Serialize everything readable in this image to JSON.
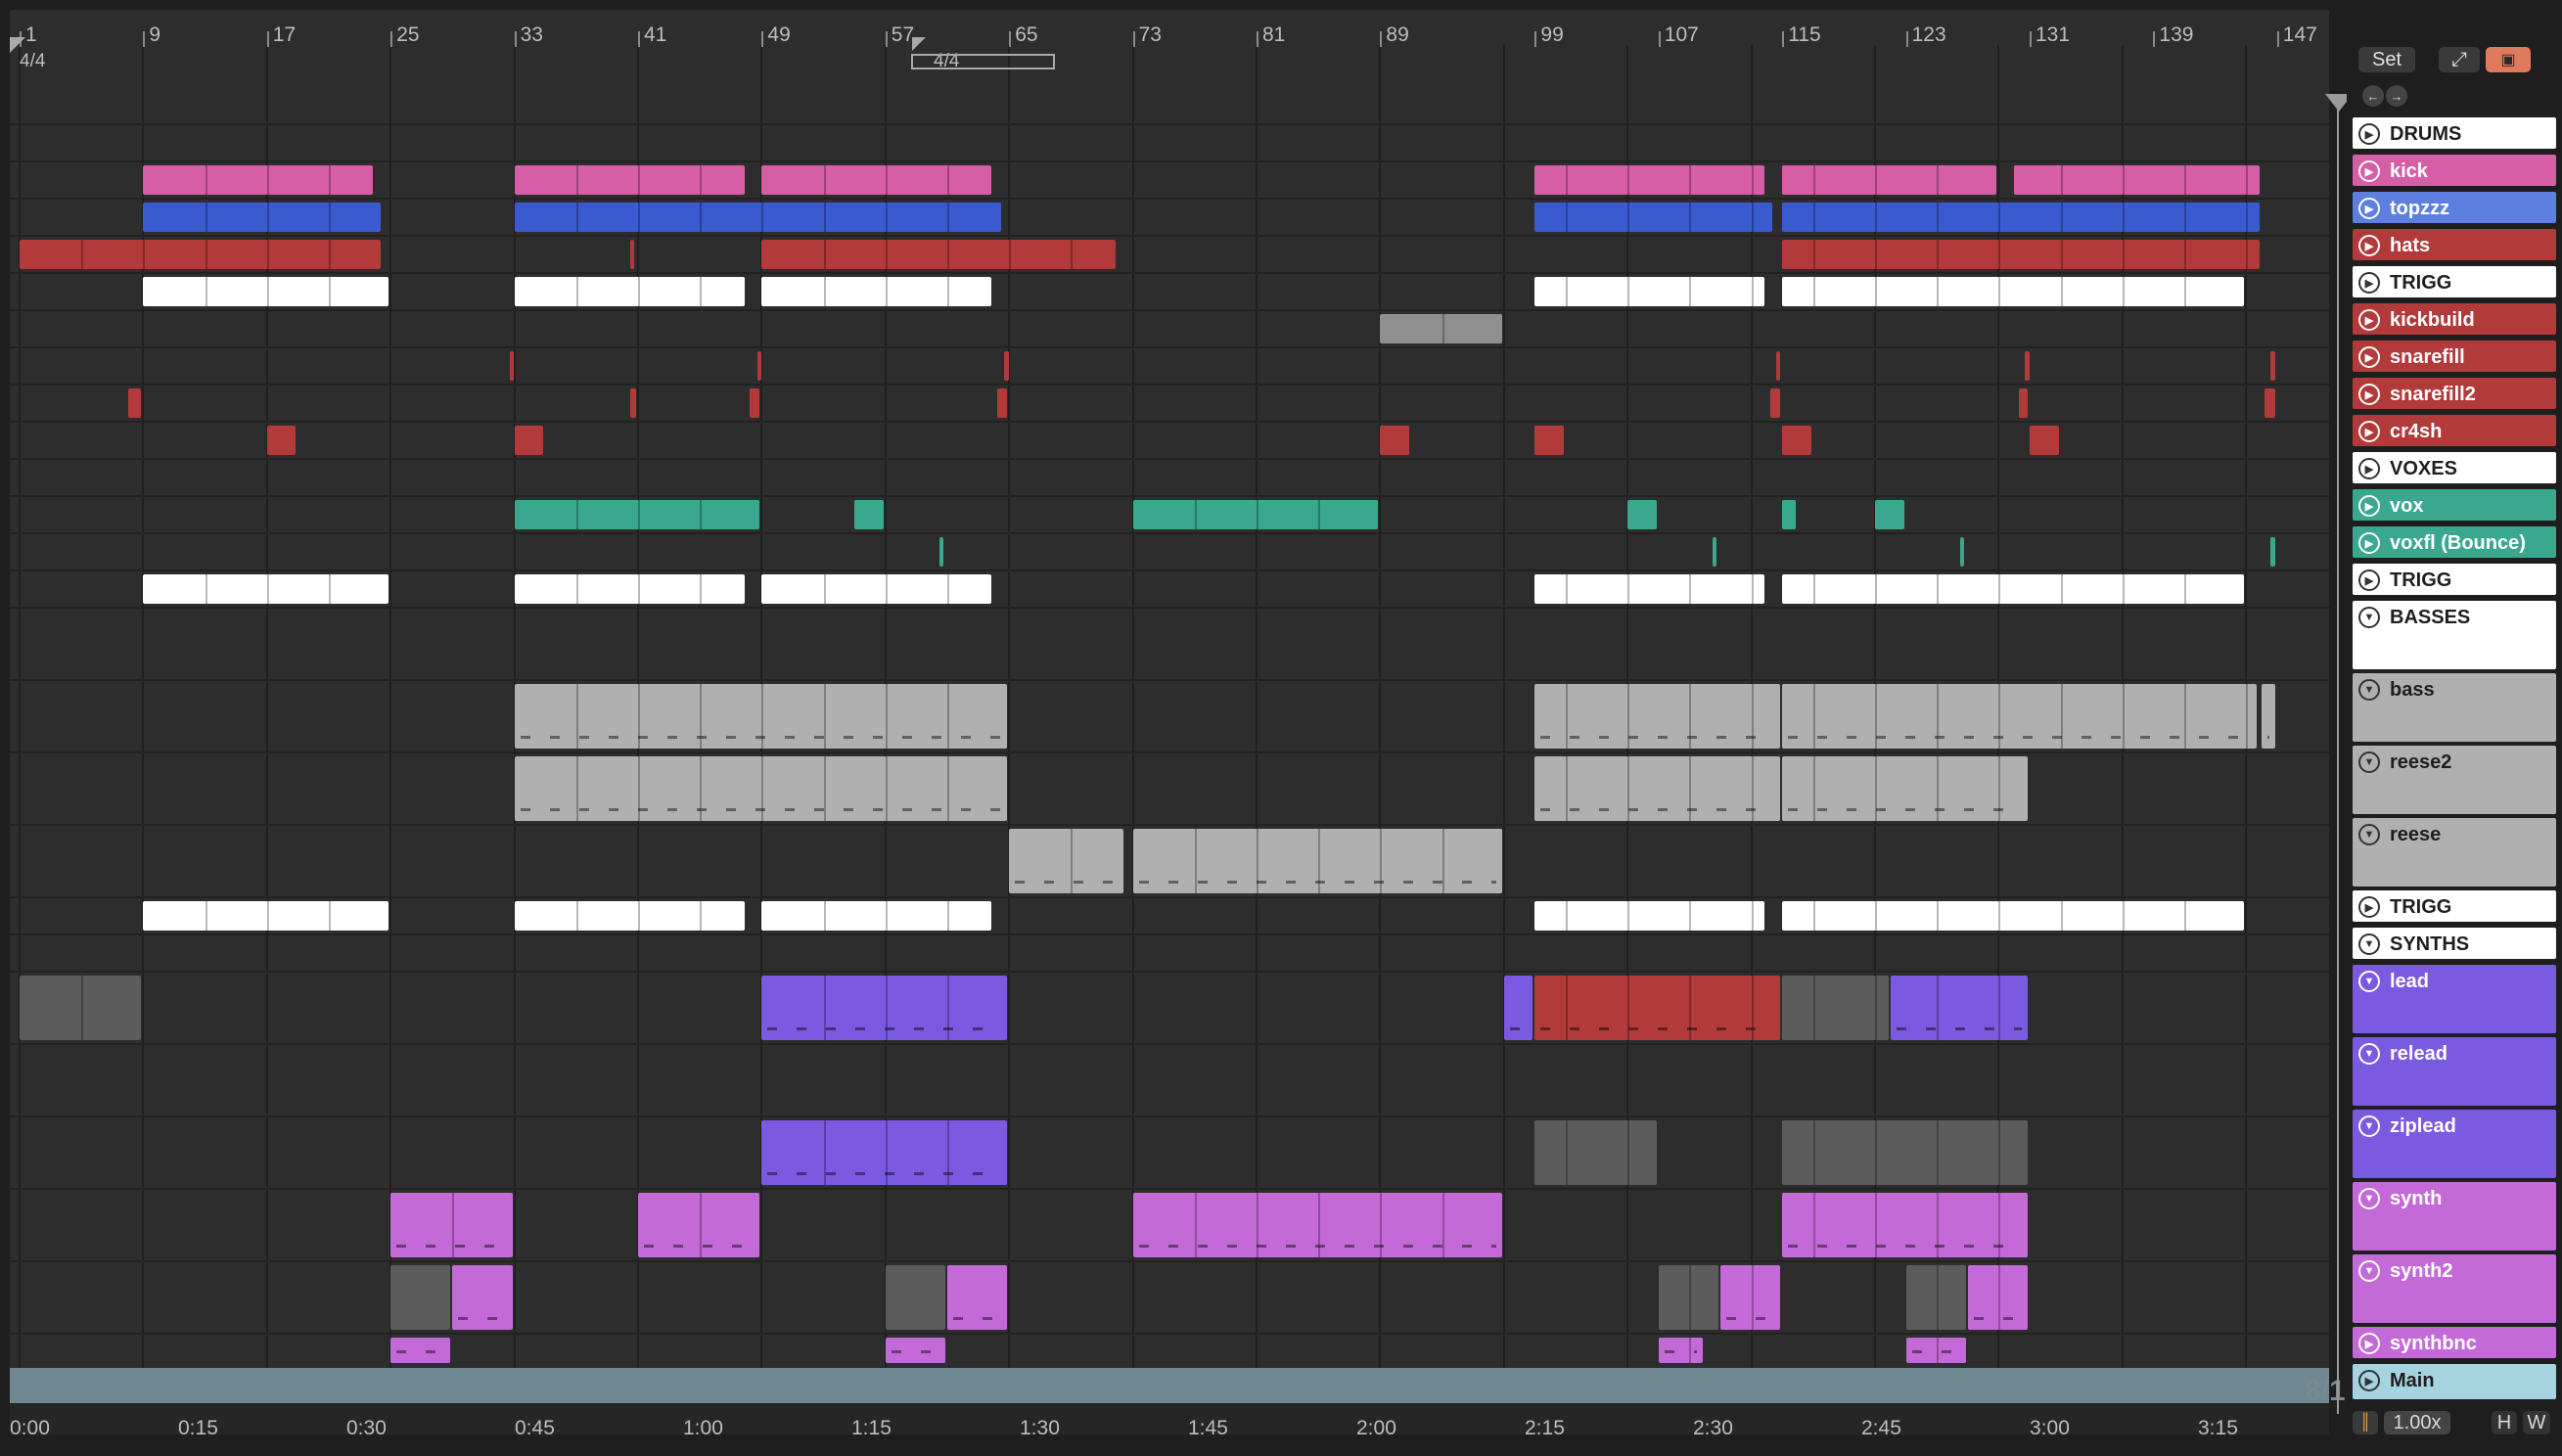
{
  "ruler": {
    "bars": [
      "1",
      "9",
      "17",
      "25",
      "33",
      "41",
      "49",
      "57",
      "65",
      "73",
      "81",
      "89",
      "99",
      "107",
      "115",
      "123",
      "131",
      "139",
      "147"
    ],
    "time_signature": "4/4",
    "loop_brace_signature": "4/4"
  },
  "timeline": {
    "times": [
      "0:00",
      "0:15",
      "0:30",
      "0:45",
      "1:00",
      "1:15",
      "1:30",
      "1:45",
      "2:00",
      "2:15",
      "2:30",
      "2:45",
      "3:00",
      "3:15"
    ]
  },
  "overview_label": "8/1",
  "controls": {
    "set_label": "Set",
    "zoom": "1.00x",
    "h_label": "H",
    "w_label": "W"
  },
  "tracks": [
    {
      "name": "DRUMS",
      "kind": "group-collapsed",
      "color": "#ffffff"
    },
    {
      "name": "kick",
      "color": "#d65ea6"
    },
    {
      "name": "topzzz",
      "color": "#5c7fe0"
    },
    {
      "name": "hats",
      "color": "#b23a3a"
    },
    {
      "name": "TRIGG",
      "color": "#ffffff"
    },
    {
      "name": "kickbuild",
      "color": "#b23a3a"
    },
    {
      "name": "snarefill",
      "color": "#b23a3a"
    },
    {
      "name": "snarefill2",
      "color": "#b23a3a"
    },
    {
      "name": "cr4sh",
      "color": "#b23a3a"
    },
    {
      "name": "VOXES",
      "kind": "group-collapsed",
      "color": "#ffffff"
    },
    {
      "name": "vox",
      "color": "#3aa88f"
    },
    {
      "name": "voxfl (Bounce)",
      "color": "#3aa88f"
    },
    {
      "name": "TRIGG",
      "color": "#ffffff"
    },
    {
      "name": "BASSES",
      "kind": "group-expanded",
      "color": "#ffffff"
    },
    {
      "name": "bass",
      "color": "#b0b0b0"
    },
    {
      "name": "reese2",
      "color": "#b0b0b0"
    },
    {
      "name": "reese",
      "color": "#b0b0b0"
    },
    {
      "name": "TRIGG",
      "color": "#ffffff"
    },
    {
      "name": "SYNTHS",
      "kind": "group-expanded",
      "color": "#ffffff"
    },
    {
      "name": "lead",
      "color": "#7a5ae0"
    },
    {
      "name": "relead",
      "color": "#7a5ae0"
    },
    {
      "name": "ziplead",
      "color": "#7a5ae0"
    },
    {
      "name": "synth",
      "color": "#c46ad8"
    },
    {
      "name": "synth2",
      "color": "#c46ad8"
    },
    {
      "name": "synthbnc",
      "color": "#c46ad8"
    },
    {
      "name": "Main",
      "color": "#a5d3e0"
    }
  ],
  "clips": [
    {
      "t": 1,
      "a": 9,
      "b": 24,
      "c": "kick"
    },
    {
      "t": 1,
      "a": 33,
      "b": 48,
      "c": "kick"
    },
    {
      "t": 1,
      "a": 49,
      "b": 64,
      "c": "kick"
    },
    {
      "t": 1,
      "a": 99,
      "b": 114,
      "c": "kick"
    },
    {
      "t": 1,
      "a": 115,
      "b": 129,
      "c": "kick"
    },
    {
      "t": 1,
      "a": 130,
      "b": 146,
      "c": "kick"
    },
    {
      "t": 2,
      "a": 9,
      "b": 24.5,
      "c": "topzzz"
    },
    {
      "t": 2,
      "a": 33,
      "b": 64.6,
      "c": "topzzz"
    },
    {
      "t": 2,
      "a": 99,
      "b": 114.5,
      "c": "topzzz"
    },
    {
      "t": 2,
      "a": 115,
      "b": 146,
      "c": "topzzz"
    },
    {
      "t": 3,
      "a": 1,
      "b": 24.5,
      "c": "hats"
    },
    {
      "t": 3,
      "a": 40.5,
      "b": 40.9,
      "c": "hats"
    },
    {
      "t": 3,
      "a": 49,
      "b": 72,
      "c": "hats"
    },
    {
      "t": 3,
      "a": 115,
      "b": 146,
      "c": "hats"
    },
    {
      "t": 4,
      "a": 9,
      "b": 25,
      "c": "trigg"
    },
    {
      "t": 4,
      "a": 33,
      "b": 48,
      "c": "trigg"
    },
    {
      "t": 4,
      "a": 49,
      "b": 64,
      "c": "trigg"
    },
    {
      "t": 4,
      "a": 99,
      "b": 114,
      "c": "trigg"
    },
    {
      "t": 4,
      "a": 115,
      "b": 145,
      "c": "trigg"
    },
    {
      "t": 5,
      "a": 89,
      "b": 97,
      "c": "kickbuild"
    },
    {
      "t": 6,
      "a": 32.7,
      "b": 33.1,
      "c": "hats"
    },
    {
      "t": 6,
      "a": 48.7,
      "b": 49.1,
      "c": "hats"
    },
    {
      "t": 6,
      "a": 64.7,
      "b": 65.1,
      "c": "hats"
    },
    {
      "t": 6,
      "a": 114.6,
      "b": 115,
      "c": "hats"
    },
    {
      "t": 6,
      "a": 130.7,
      "b": 131.1,
      "c": "hats"
    },
    {
      "t": 6,
      "a": 146.6,
      "b": 147,
      "c": "hats"
    },
    {
      "t": 7,
      "a": 8,
      "b": 9,
      "c": "hats"
    },
    {
      "t": 7,
      "a": 40.5,
      "b": 41,
      "c": "hats"
    },
    {
      "t": 7,
      "a": 48.2,
      "b": 49,
      "c": "hats"
    },
    {
      "t": 7,
      "a": 64.2,
      "b": 65,
      "c": "hats"
    },
    {
      "t": 7,
      "a": 114.2,
      "b": 115,
      "c": "hats"
    },
    {
      "t": 7,
      "a": 130.3,
      "b": 131,
      "c": "hats"
    },
    {
      "t": 7,
      "a": 146.2,
      "b": 147,
      "c": "hats"
    },
    {
      "t": 8,
      "a": 17,
      "b": 19,
      "c": "hats"
    },
    {
      "t": 8,
      "a": 33,
      "b": 35,
      "c": "hats"
    },
    {
      "t": 8,
      "a": 89,
      "b": 91,
      "c": "hats"
    },
    {
      "t": 8,
      "a": 99,
      "b": 101,
      "c": "hats"
    },
    {
      "t": 8,
      "a": 115,
      "b": 117,
      "c": "hats"
    },
    {
      "t": 8,
      "a": 131,
      "b": 133,
      "c": "hats"
    },
    {
      "t": 10,
      "a": 33,
      "b": 49,
      "c": "vox"
    },
    {
      "t": 10,
      "a": 55,
      "b": 57,
      "c": "vox"
    },
    {
      "t": 10,
      "a": 73,
      "b": 89,
      "c": "vox"
    },
    {
      "t": 10,
      "a": 105,
      "b": 107,
      "c": "vox"
    },
    {
      "t": 10,
      "a": 115,
      "b": 116,
      "c": "vox"
    },
    {
      "t": 10,
      "a": 121,
      "b": 123,
      "c": "vox"
    },
    {
      "t": 11,
      "a": 60.5,
      "b": 60.9,
      "c": "vox"
    },
    {
      "t": 11,
      "a": 110.5,
      "b": 110.9,
      "c": "vox"
    },
    {
      "t": 11,
      "a": 126.5,
      "b": 126.9,
      "c": "vox"
    },
    {
      "t": 11,
      "a": 146.6,
      "b": 147,
      "c": "vox"
    },
    {
      "t": 12,
      "a": 9,
      "b": 25,
      "c": "trigg"
    },
    {
      "t": 12,
      "a": 33,
      "b": 48,
      "c": "trigg"
    },
    {
      "t": 12,
      "a": 49,
      "b": 64,
      "c": "trigg"
    },
    {
      "t": 12,
      "a": 99,
      "b": 114,
      "c": "trigg"
    },
    {
      "t": 12,
      "a": 115,
      "b": 145,
      "c": "trigg"
    },
    {
      "t": 14,
      "a": 33,
      "b": 65,
      "c": "bass"
    },
    {
      "t": 14,
      "a": 99,
      "b": 115,
      "c": "bass"
    },
    {
      "t": 14,
      "a": 115,
      "b": 145.8,
      "c": "bass"
    },
    {
      "t": 14,
      "a": 146,
      "b": 147,
      "c": "bass"
    },
    {
      "t": 15,
      "a": 33,
      "b": 65,
      "c": "bass"
    },
    {
      "t": 15,
      "a": 99,
      "b": 115,
      "c": "bass"
    },
    {
      "t": 15,
      "a": 115,
      "b": 131,
      "c": "bass"
    },
    {
      "t": 16,
      "a": 65,
      "b": 72.5,
      "c": "bass"
    },
    {
      "t": 16,
      "a": 73,
      "b": 97,
      "c": "bass"
    },
    {
      "t": 17,
      "a": 9,
      "b": 25,
      "c": "trigg"
    },
    {
      "t": 17,
      "a": 33,
      "b": 48,
      "c": "trigg"
    },
    {
      "t": 17,
      "a": 49,
      "b": 64,
      "c": "trigg"
    },
    {
      "t": 17,
      "a": 99,
      "b": 114,
      "c": "trigg"
    },
    {
      "t": 17,
      "a": 115,
      "b": 145,
      "c": "trigg"
    },
    {
      "t": 19,
      "a": 1,
      "b": 9,
      "c": "greyclip"
    },
    {
      "t": 19,
      "a": 49,
      "b": 65,
      "c": "lead"
    },
    {
      "t": 19,
      "a": 97,
      "b": 99,
      "c": "lead"
    },
    {
      "t": 19,
      "a": 99,
      "b": 115,
      "c": "redclip"
    },
    {
      "t": 19,
      "a": 115,
      "b": 122,
      "c": "greyclip"
    },
    {
      "t": 19,
      "a": 122,
      "b": 131,
      "c": "lead"
    },
    {
      "t": 21,
      "a": 49,
      "b": 65,
      "c": "lead"
    },
    {
      "t": 21,
      "a": 99,
      "b": 107,
      "c": "greyclip"
    },
    {
      "t": 21,
      "a": 115,
      "b": 131,
      "c": "greyclip"
    },
    {
      "t": 22,
      "a": 25,
      "b": 33,
      "c": "synth"
    },
    {
      "t": 22,
      "a": 41,
      "b": 49,
      "c": "synth"
    },
    {
      "t": 22,
      "a": 73,
      "b": 97,
      "c": "synth"
    },
    {
      "t": 22,
      "a": 115,
      "b": 131,
      "c": "synth"
    },
    {
      "t": 23,
      "a": 25,
      "b": 29,
      "c": "greyclip"
    },
    {
      "t": 23,
      "a": 29,
      "b": 33,
      "c": "synth"
    },
    {
      "t": 23,
      "a": 57,
      "b": 61,
      "c": "greyclip"
    },
    {
      "t": 23,
      "a": 61,
      "b": 65,
      "c": "synth"
    },
    {
      "t": 23,
      "a": 107,
      "b": 111,
      "c": "greyclip"
    },
    {
      "t": 23,
      "a": 111,
      "b": 115,
      "c": "synth"
    },
    {
      "t": 23,
      "a": 123,
      "b": 127,
      "c": "greyclip"
    },
    {
      "t": 23,
      "a": 127,
      "b": 131,
      "c": "synth"
    },
    {
      "t": 24,
      "a": 25,
      "b": 29,
      "c": "synth"
    },
    {
      "t": 24,
      "a": 57,
      "b": 61,
      "c": "synth"
    },
    {
      "t": 24,
      "a": 107,
      "b": 110,
      "c": "synth"
    },
    {
      "t": 24,
      "a": 123,
      "b": 127,
      "c": "synth"
    }
  ]
}
